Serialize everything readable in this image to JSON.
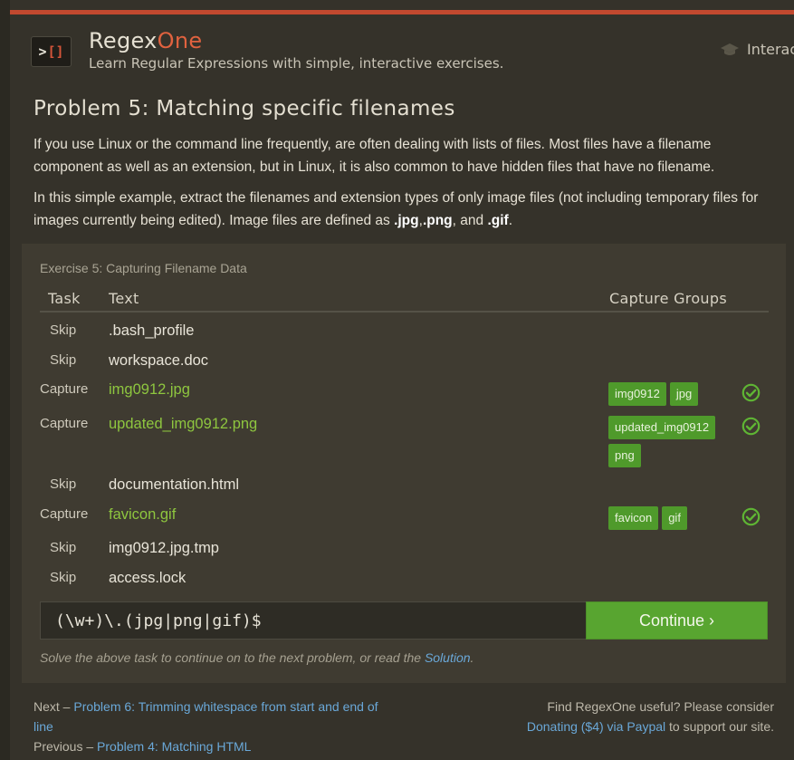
{
  "header": {
    "brand_regex": "Regex",
    "brand_one": "One",
    "tagline": "Learn Regular Expressions with simple, interactive exercises.",
    "nav_interactive": "Interac"
  },
  "problem": {
    "title": "Problem 5: Matching specific filenames",
    "p1": "If you use Linux or the command line frequently, are often dealing with lists of files. Most files have a filename component as well as an extension, but in Linux, it is also common to have hidden files that have no filename.",
    "p2_prefix": "In this simple example, extract the filenames and extension types of only image files (not including temporary files for images currently being edited). Image files are defined as ",
    "p2_jpg": ".jpg",
    "p2_comma1": ",",
    "p2_png": ".png",
    "p2_and": ", and ",
    "p2_gif": ".gif",
    "p2_end": "."
  },
  "exercise": {
    "title": "Exercise 5: Capturing Filename Data",
    "col_task": "Task",
    "col_text": "Text",
    "col_groups": "Capture Groups",
    "rows": [
      {
        "task": "Skip",
        "text": ".bash_profile",
        "groups": []
      },
      {
        "task": "Skip",
        "text": "workspace.doc",
        "groups": []
      },
      {
        "task": "Capture",
        "text": "img0912.jpg",
        "groups": [
          "img0912",
          "jpg"
        ]
      },
      {
        "task": "Capture",
        "text": "updated_img0912.png",
        "groups": [
          "updated_img0912",
          "png"
        ]
      },
      {
        "task": "Skip",
        "text": "documentation.html",
        "groups": []
      },
      {
        "task": "Capture",
        "text": "favicon.gif",
        "groups": [
          "favicon",
          "gif"
        ]
      },
      {
        "task": "Skip",
        "text": "img0912.jpg.tmp",
        "groups": []
      },
      {
        "task": "Skip",
        "text": "access.lock",
        "groups": []
      }
    ],
    "regex_value": "(\\w+)\\.(jpg|png|gif)$",
    "continue_label": "Continue ›",
    "solve_prefix": "Solve the above task to continue on to the next problem, or read the ",
    "solve_link": "Solution",
    "solve_suffix": "."
  },
  "footer": {
    "next_prefix": "Next – ",
    "next_link": "Problem 6: Trimming whitespace from start and end of line",
    "prev_prefix": "Previous – ",
    "prev_link": "Problem 4: Matching HTML",
    "support_text": "Find RegexOne useful? Please consider",
    "donate_link": "Donating ($4) via Paypal",
    "support_suffix": " to support our site."
  },
  "colors": {
    "accent": "#c2492f",
    "capture_green": "#8ec63f",
    "chip_green": "#4f9a2b",
    "button_green": "#58a530",
    "link_blue": "#6aa8d8"
  }
}
